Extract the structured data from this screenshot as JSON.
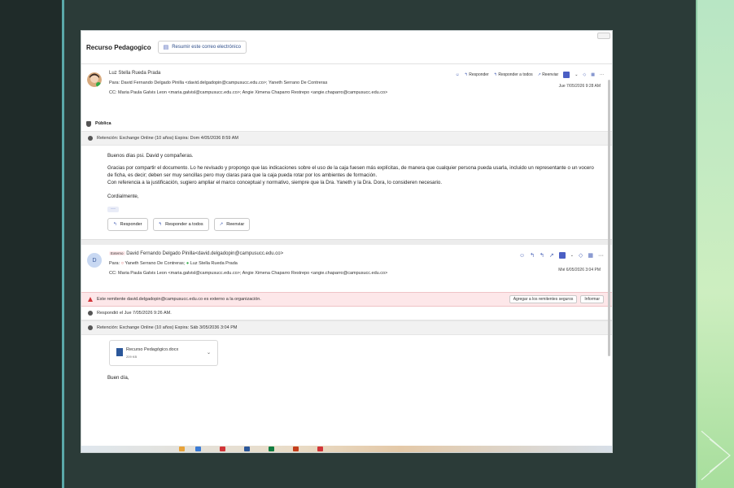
{
  "email": {
    "subject": "Recurso Pedagogico",
    "summarize_label": "Resumir este correo electrónico",
    "messages": [
      {
        "sender": "Luz Stella Rueda Prada",
        "to": "Para: David Fernando Delgado Pinilla <david.delgadopin@campusucc.edu.co>;  Yaneth Serrano De Contreras",
        "cc": "CC: Maria Paula Galvis Leon <maria.galvisl@campusucc.edu.co>;  Angie Ximena Chaparro Restrepo <angie.chaparro@campusucc.edu.co>",
        "date": "Jue 7/05/2026 9:28 AM",
        "actions": {
          "reply": "Responder",
          "reply_all": "Responder a todos",
          "forward": "Reenviar"
        },
        "label": "Pública",
        "retention": "Retención: Exchange Online (10 años) Expira: Dom 4/05/2036 8:59 AM",
        "body": [
          "Buenos días psi. David y compañeras.",
          "Gracias por compartir el documento. Lo he revisado y propongo que las indicaciones sobre el uso de la caja fuesen más explícitas, de manera que cualquier persona pueda usarla, incluido un representante o un vocero de ficha, es decir; deben ser muy sencillas pero muy claras para que la caja pueda rotar por los ambientes de formación.",
          "Con referencia a la justificación, sugiero ampliar el marco conceptual y normativo, siempre que la Dra. Yaneth y la Dra. Dora, lo consideren necesario.",
          "Cordialmente,"
        ],
        "more": "···",
        "buttons": {
          "reply": "Responder",
          "reply_all": "Responder a todos",
          "forward": "Reenviar"
        }
      },
      {
        "avatar_letter": "D",
        "external_tag": "Externo",
        "sender": "David Fernando Delgado Pinilla<david.delgadopin@campusucc.edu.co>",
        "to_prefix": "Para:",
        "to_yaneth": "Yaneth Serrano De Contreras;",
        "to_luz": "Luz Stella Rueda Prada",
        "cc": "CC: Maria Paula Galvis Leon <maria.galvisl@campusucc.edu.co>;  Angie Ximena Chaparro Restrepo <angie.chaparro@campusucc.edu.co>",
        "date": "Mié 6/05/2026 3:04 PM",
        "warning": "Este remitente david.delgadopin@campusucc.edu.co es externo a la organización.",
        "add_safe": "Agregar a los remitentes seguros",
        "report": "Informar",
        "replied": "Respondió el Jue 7/05/2026 9:26 AM.",
        "retention": "Retención: Exchange Online (10 años) Expira: Sáb 3/05/2036 3:04 PM",
        "attachment": {
          "name": "Recurso Pedagógico.docx",
          "size": "209 KB"
        },
        "body_start": "Buen día,"
      }
    ]
  },
  "colors": {
    "accent": "#4b64b8",
    "warning_bg": "#fde7e9",
    "slide_bg": "#2b3b38",
    "teal_line": "#5aa8a8"
  }
}
